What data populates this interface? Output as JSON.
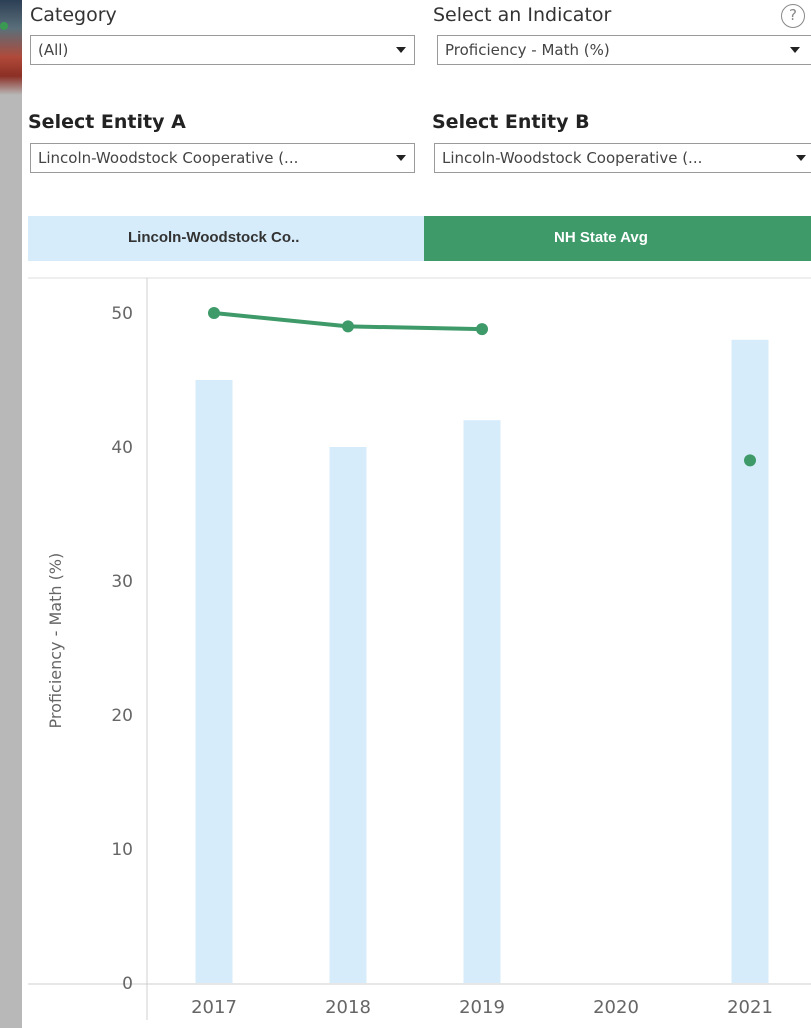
{
  "filters": {
    "category": {
      "label": "Category",
      "value": "(All)"
    },
    "indicator": {
      "label": "Select an Indicator",
      "value": "Proficiency - Math (%)"
    },
    "entity_a": {
      "label": "Select Entity A",
      "value": "Lincoln-Woodstock Cooperative (..."
    },
    "entity_b": {
      "label": "Select Entity B",
      "value": "Lincoln-Woodstock Cooperative (..."
    },
    "help_icon": "?"
  },
  "legend": {
    "entity_a": "Lincoln-Woodstock Co..",
    "entity_b": "NH State Avg"
  },
  "colors": {
    "bar": "#d6ecfa",
    "line": "#3f9a6a"
  },
  "chart_data": {
    "type": "bar",
    "categories": [
      "2017",
      "2018",
      "2019",
      "2020",
      "2021"
    ],
    "series": [
      {
        "name": "Lincoln-Woodstock Co..",
        "values": [
          45,
          40,
          42,
          null,
          48
        ]
      },
      {
        "name": "NH State Avg",
        "values": [
          50,
          49,
          48.8,
          null,
          39
        ]
      }
    ],
    "ylabel": "Proficiency - Math (%)",
    "yticks": [
      0,
      10,
      20,
      30,
      40,
      50
    ],
    "ylim": [
      0,
      52.5
    ]
  }
}
